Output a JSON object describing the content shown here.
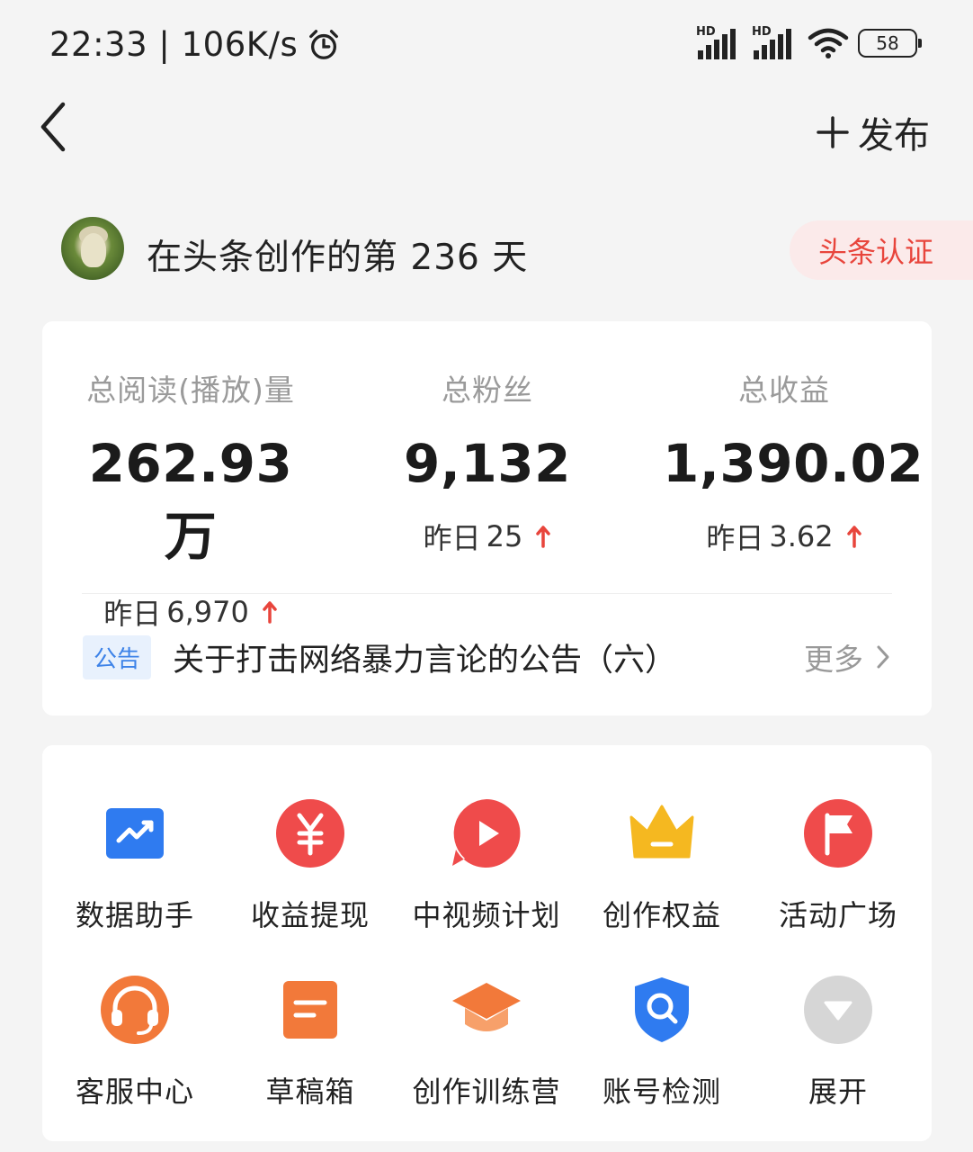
{
  "status_bar": {
    "time": "22:33",
    "speed": "106K/s",
    "battery": "58",
    "network_label": "HD"
  },
  "nav": {
    "publish_label": "发布"
  },
  "profile": {
    "days_text": "在头条创作的第 236 天",
    "cert_label": "头条认证"
  },
  "stats": [
    {
      "label": "总阅读(播放)量",
      "value": "262.93万",
      "yesterday_label": "昨日",
      "yesterday_value": "6,970"
    },
    {
      "label": "总粉丝",
      "value": "9,132",
      "yesterday_label": "昨日",
      "yesterday_value": "25"
    },
    {
      "label": "总收益",
      "value": "1,390.02",
      "yesterday_label": "昨日",
      "yesterday_value": "3.62"
    }
  ],
  "notice": {
    "tag": "公告",
    "text": "关于打击网络暴力言论的公告（六）",
    "more": "更多"
  },
  "tools": [
    {
      "label": "数据助手",
      "icon": "data-assistant-icon",
      "color": "#2f7bf0"
    },
    {
      "label": "收益提现",
      "icon": "yuan-withdraw-icon",
      "color": "#ef4b4b"
    },
    {
      "label": "中视频计划",
      "icon": "play-video-icon",
      "color": "#ef4b4b"
    },
    {
      "label": "创作权益",
      "icon": "crown-icon",
      "color": "#f5b820"
    },
    {
      "label": "活动广场",
      "icon": "flag-icon",
      "color": "#ef4b4b"
    },
    {
      "label": "客服中心",
      "icon": "headset-icon",
      "color": "#f2793a"
    },
    {
      "label": "草稿箱",
      "icon": "draft-box-icon",
      "color": "#f2793a"
    },
    {
      "label": "创作训练营",
      "icon": "graduation-cap-icon",
      "color": "#f2793a"
    },
    {
      "label": "账号检测",
      "icon": "shield-search-icon",
      "color": "#2f7bf0"
    },
    {
      "label": "展开",
      "icon": "expand-down-icon",
      "color": "#cfcfcf"
    }
  ],
  "colors": {
    "accent_red": "#e8453c",
    "notice_blue": "#3c82e8"
  }
}
